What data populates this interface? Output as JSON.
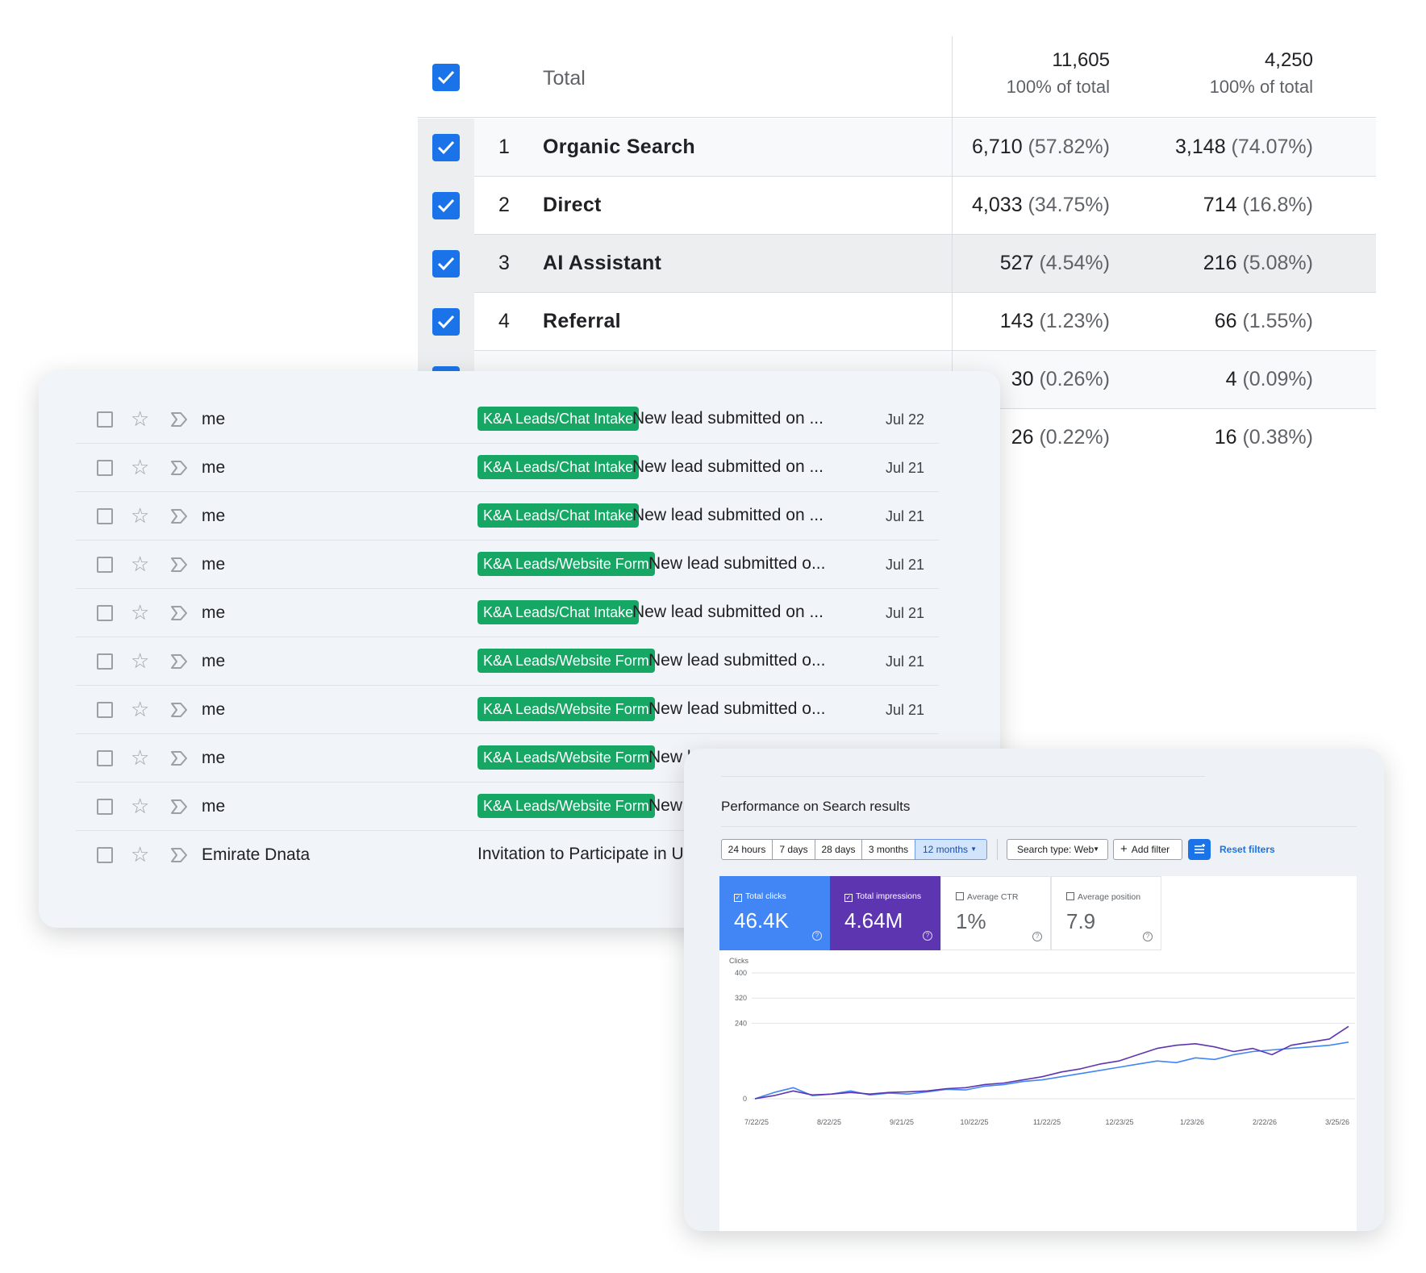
{
  "analytics": {
    "total": {
      "label": "Total",
      "v1": "11,605",
      "v1_sub": "100% of total",
      "v2": "4,250",
      "v2_sub": "100% of total"
    },
    "rows": [
      {
        "num": "1",
        "name": "Organic Search",
        "v1": "6,710",
        "p1": "(57.82%)",
        "v2": "3,148",
        "p2": "(74.07%)"
      },
      {
        "num": "2",
        "name": "Direct",
        "v1": "4,033",
        "p1": "(34.75%)",
        "v2": "714",
        "p2": "(16.8%)"
      },
      {
        "num": "3",
        "name": "AI Assistant",
        "v1": "527",
        "p1": "(4.54%)",
        "v2": "216",
        "p2": "(5.08%)"
      },
      {
        "num": "4",
        "name": "Referral",
        "v1": "143",
        "p1": "(1.23%)",
        "v2": "66",
        "p2": "(1.55%)"
      },
      {
        "num": "",
        "name": "",
        "v1": "30",
        "p1": "(0.26%)",
        "v2": "4",
        "p2": "(0.09%)"
      },
      {
        "num": "",
        "name": "",
        "v1": "26",
        "p1": "(0.22%)",
        "v2": "16",
        "p2": "(0.38%)"
      }
    ]
  },
  "gmail": {
    "rows": [
      {
        "sender": "me",
        "label": "K&A Leads/Chat Intake",
        "subject": "New lead submitted on ...",
        "date": "Jul 22"
      },
      {
        "sender": "me",
        "label": "K&A Leads/Chat Intake",
        "subject": "New lead submitted on ...",
        "date": "Jul 21"
      },
      {
        "sender": "me",
        "label": "K&A Leads/Chat Intake",
        "subject": "New lead submitted on ...",
        "date": "Jul 21"
      },
      {
        "sender": "me",
        "label": "K&A Leads/Website Form",
        "subject": "New lead submitted o...",
        "date": "Jul 21"
      },
      {
        "sender": "me",
        "label": "K&A Leads/Chat Intake",
        "subject": "New lead submitted on ...",
        "date": "Jul 21"
      },
      {
        "sender": "me",
        "label": "K&A Leads/Website Form",
        "subject": "New lead submitted o...",
        "date": "Jul 21"
      },
      {
        "sender": "me",
        "label": "K&A Leads/Website Form",
        "subject": "New lead submitted o...",
        "date": "Jul 21"
      },
      {
        "sender": "me",
        "label": "K&A Leads/Website Form",
        "subject": "New lea",
        "date": ""
      },
      {
        "sender": "me",
        "label": "K&A Leads/Website Form",
        "subject": "New lea",
        "date": ""
      },
      {
        "sender": "Emirate Dnata",
        "label": "",
        "subject": "Invitation to Participate in Upco",
        "date": ""
      }
    ]
  },
  "search_console": {
    "title": "Performance on Search results",
    "ranges": [
      "24 hours",
      "7 days",
      "28 days",
      "3 months",
      "12 months"
    ],
    "selected_range": "12 months",
    "search_type": "Search type: Web",
    "add_filter": "Add filter",
    "reset": "Reset filters",
    "metrics": [
      {
        "label": "Total clicks",
        "value": "46.4K",
        "checked": true
      },
      {
        "label": "Total impressions",
        "value": "4.64M",
        "checked": true
      },
      {
        "label": "Average CTR",
        "value": "1%",
        "checked": false
      },
      {
        "label": "Average position",
        "value": "7.9",
        "checked": false
      }
    ]
  },
  "chart_data": {
    "type": "line",
    "ylabel": "Clicks",
    "yticks": [
      "400",
      "320",
      "240",
      "0"
    ],
    "xticks": [
      "7/22/25",
      "8/22/25",
      "9/21/25",
      "10/22/25",
      "11/22/25",
      "12/23/25",
      "1/23/26",
      "2/22/26",
      "3/25/26"
    ],
    "series": [
      {
        "color": "#4285f4",
        "values": [
          0,
          20,
          35,
          10,
          15,
          25,
          12,
          18,
          15,
          22,
          30,
          28,
          40,
          45,
          55,
          60,
          70,
          80,
          90,
          100,
          110,
          120,
          115,
          130,
          125,
          140,
          150,
          155,
          160,
          165,
          170,
          180
        ]
      },
      {
        "color": "#5e35b1",
        "values": [
          0,
          10,
          25,
          12,
          15,
          20,
          15,
          20,
          22,
          25,
          32,
          35,
          45,
          50,
          60,
          70,
          85,
          95,
          110,
          120,
          140,
          160,
          170,
          175,
          165,
          150,
          160,
          140,
          170,
          180,
          190,
          230
        ]
      }
    ]
  }
}
